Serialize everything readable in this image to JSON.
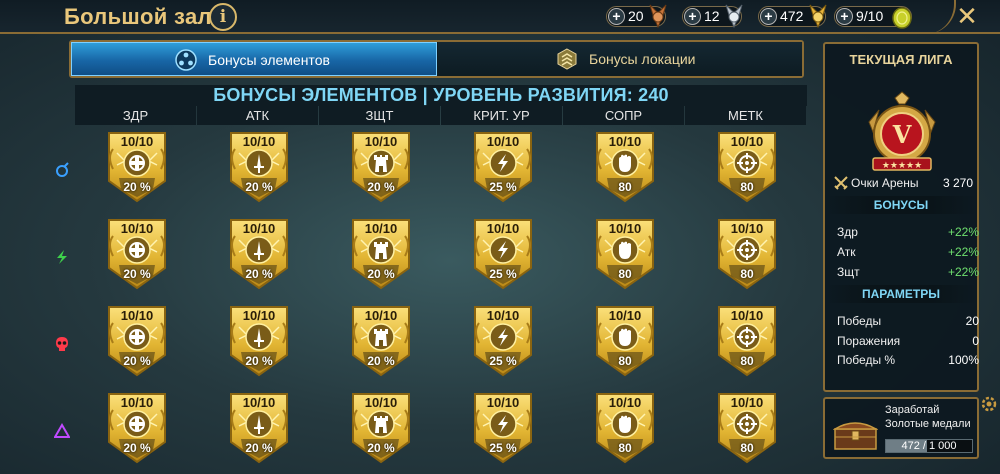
{
  "header": {
    "title": "Большой зал",
    "info_icon": "info-icon",
    "close_icon": "close-icon"
  },
  "resources": [
    {
      "name": "bronze-medal",
      "value": "20",
      "color": "#c9753a"
    },
    {
      "name": "silver-medal",
      "value": "12",
      "color": "#c0c8d0"
    },
    {
      "name": "gold-medal",
      "value": "472",
      "color": "#e8b43a"
    },
    {
      "name": "arena-token",
      "value": "9/10",
      "color": "#c8d02a"
    }
  ],
  "tabs": [
    {
      "label": "Бонусы элементов",
      "active": true,
      "icon": "elements-icon"
    },
    {
      "label": "Бонусы локации",
      "active": false,
      "icon": "location-icon"
    }
  ],
  "table": {
    "title": "БОНУСЫ ЭЛЕМЕНТОВ | УРОВЕНЬ РАЗВИТИЯ: 240",
    "columns": [
      {
        "label": "ЗДР",
        "symbol": "health-icon",
        "value": "20 %"
      },
      {
        "label": "АТК",
        "symbol": "sword-icon",
        "value": "20 %"
      },
      {
        "label": "ЗЩТ",
        "symbol": "tower-icon",
        "value": "20 %"
      },
      {
        "label": "КРИТ. УР",
        "symbol": "lightning-icon",
        "value": "25 %"
      },
      {
        "label": "СОПР",
        "symbol": "fist-icon",
        "value": "80"
      },
      {
        "label": "МЕТК",
        "symbol": "crosshair-icon",
        "value": "80"
      }
    ],
    "rows": [
      {
        "element": "magic-element-icon",
        "color": "#3aa0ff",
        "level": "10/10"
      },
      {
        "element": "force-element-icon",
        "color": "#3ed14b",
        "level": "10/10"
      },
      {
        "element": "spirit-element-icon",
        "color": "#ff3a4a",
        "level": "10/10"
      },
      {
        "element": "void-element-icon",
        "color": "#c04aff",
        "level": "10/10"
      }
    ]
  },
  "league": {
    "title": "ТЕКУЩАЯ ЛИГА",
    "rank_letter": "V",
    "arena_points_label": "Очки Арены",
    "arena_points_value": "3 270",
    "bonuses_title": "БОНУСЫ",
    "bonuses": [
      {
        "label": "Здр",
        "value": "+22%"
      },
      {
        "label": "Атк",
        "value": "+22%"
      },
      {
        "label": "Зщт",
        "value": "+22%"
      }
    ],
    "params_title": "ПАРАМЕТРЫ",
    "params": [
      {
        "label": "Победы",
        "value": "20"
      },
      {
        "label": "Поражения",
        "value": "0"
      },
      {
        "label": "Победы %",
        "value": "100%"
      }
    ]
  },
  "reward": {
    "line1": "Заработай",
    "line2": "Золотые медали",
    "progress_text": "472 / 1 000",
    "progress_fraction": 0.472
  },
  "colors": {
    "gold": "#e9c77b",
    "accent_blue": "#2f9ed9",
    "positive": "#6fe06f"
  }
}
